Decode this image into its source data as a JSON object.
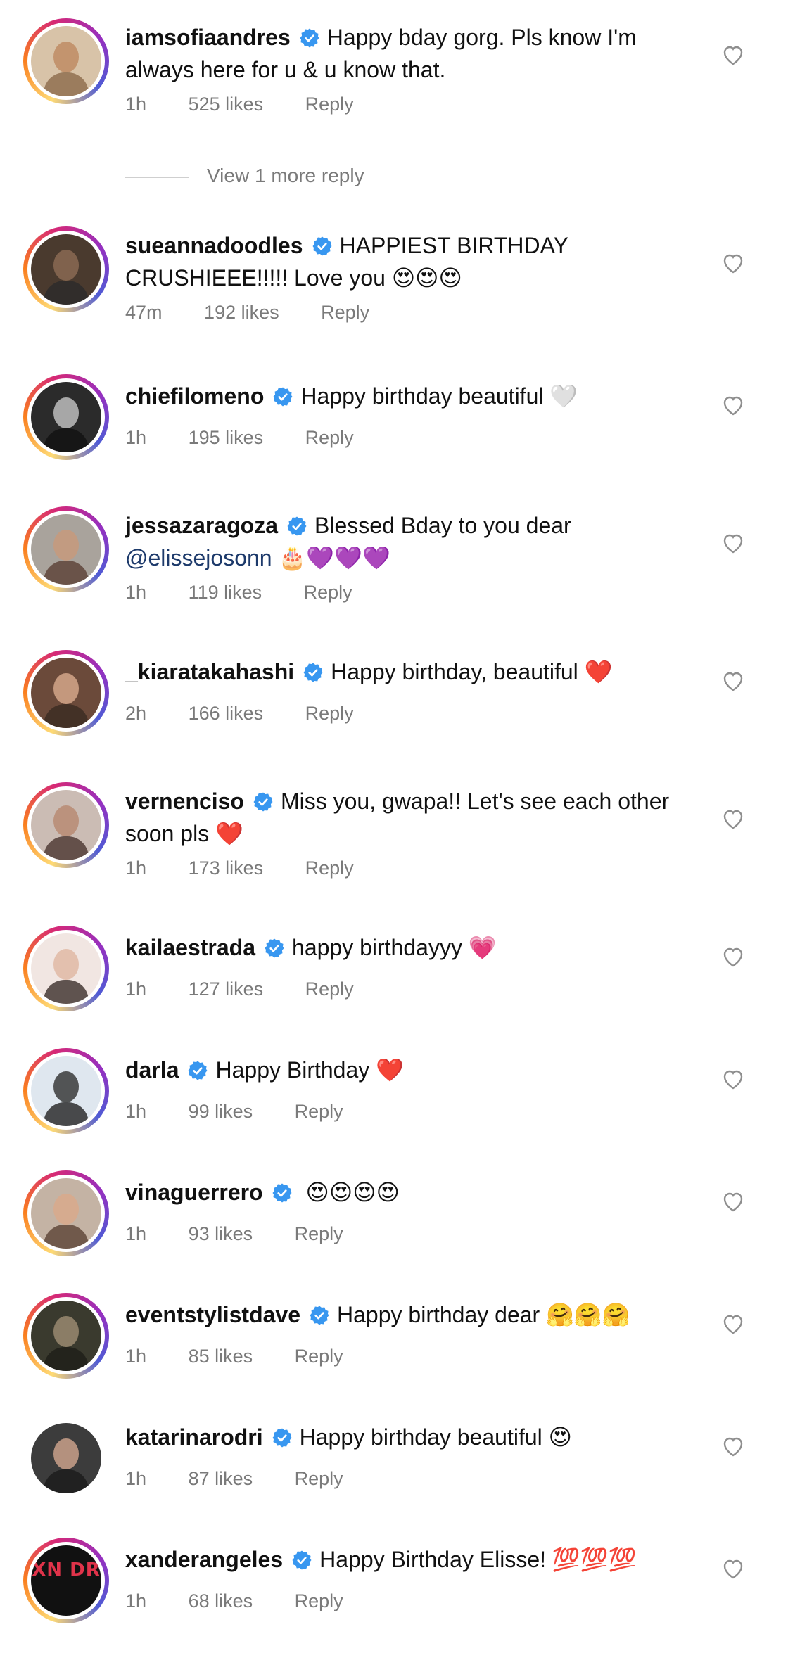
{
  "view_more": {
    "label": "View 1 more reply",
    "after_index": 0
  },
  "comments": [
    {
      "username": "iamsofiaandres",
      "text": "Happy bday gorg. Pls know I'm always here for u & u know that.",
      "mention": "",
      "emoji": "",
      "time": "1h",
      "likes": "525 likes",
      "reply": "Reply",
      "avatar": {
        "ring": true,
        "bg": "#d8c3a8",
        "face": "#c08c64",
        "torso": "#8c6a4a",
        "text": ""
      }
    },
    {
      "username": "sueannadoodles",
      "text": "HAPPIEST BIRTHDAY CRUSHIEEE!!!!! Love you",
      "mention": "",
      "emoji": "😍😍😍",
      "time": "47m",
      "likes": "192 likes",
      "reply": "Reply",
      "avatar": {
        "ring": true,
        "bg": "#4a3a2e",
        "face": "#8a6a52",
        "torso": "#2a2a2a",
        "text": ""
      }
    },
    {
      "username": "chiefilomeno",
      "text": "Happy birthday beautiful",
      "mention": "",
      "emoji": "🤍",
      "time": "1h",
      "likes": "195 likes",
      "reply": "Reply",
      "avatar": {
        "ring": true,
        "bg": "#2b2b2b",
        "face": "#bdbdbd",
        "torso": "#111111",
        "text": ""
      }
    },
    {
      "username": "jessazaragoza",
      "text": "Blessed Bday to you dear",
      "mention": "@elissejosonn",
      "emoji": "🎂💜💜💜",
      "time": "1h",
      "likes": "119 likes",
      "reply": "Reply",
      "avatar": {
        "ring": true,
        "bg": "#a9a39c",
        "face": "#c79a7c",
        "torso": "#5a3e34",
        "text": ""
      }
    },
    {
      "username": "_kiaratakahashi",
      "text": "Happy birthday, beautiful",
      "mention": "",
      "emoji": "❤️",
      "time": "2h",
      "likes": "166 likes",
      "reply": "Reply",
      "avatar": {
        "ring": true,
        "bg": "#6b4a3a",
        "face": "#d4a68a",
        "torso": "#3a2a22",
        "text": ""
      }
    },
    {
      "username": "vernenciso",
      "text": "Miss you, gwapa!! Let's see each other soon pls",
      "mention": "",
      "emoji": "❤️",
      "time": "1h",
      "likes": "173 likes",
      "reply": "Reply",
      "avatar": {
        "ring": true,
        "bg": "#cbbcb4",
        "face": "#b98b73",
        "torso": "#4a3530",
        "text": ""
      }
    },
    {
      "username": "kailaestrada",
      "text": "happy birthdayyy",
      "mention": "",
      "emoji": "💗",
      "time": "1h",
      "likes": "127 likes",
      "reply": "Reply",
      "avatar": {
        "ring": true,
        "bg": "#f1e6e2",
        "face": "#e0b8a4",
        "torso": "#3b2e2a",
        "text": ""
      }
    },
    {
      "username": "darla",
      "text": "Happy Birthday",
      "mention": "",
      "emoji": "❤️",
      "time": "1h",
      "likes": "99 likes",
      "reply": "Reply",
      "avatar": {
        "ring": true,
        "bg": "#dfe7ef",
        "face": "#3a3a3a",
        "torso": "#222222",
        "text": ""
      }
    },
    {
      "username": "vinaguerrero",
      "text": "",
      "mention": "",
      "emoji": "😍😍😍😍",
      "time": "1h",
      "likes": "93 likes",
      "reply": "Reply",
      "avatar": {
        "ring": true,
        "bg": "#c4b3a4",
        "face": "#d9a98c",
        "torso": "#5b4234",
        "text": ""
      }
    },
    {
      "username": "eventstylistdave",
      "text": "Happy birthday dear",
      "mention": "",
      "emoji": "🤗🤗🤗",
      "time": "1h",
      "likes": "85 likes",
      "reply": "Reply",
      "avatar": {
        "ring": true,
        "bg": "#3a3a2e",
        "face": "#9a8a70",
        "torso": "#1e1e18",
        "text": ""
      }
    },
    {
      "username": "katarinarodri",
      "text": "Happy birthday beautiful",
      "mention": "",
      "emoji": "😍",
      "time": "1h",
      "likes": "87 likes",
      "reply": "Reply",
      "avatar": {
        "ring": false,
        "bg": "#3c3c3c",
        "face": "#c9a08a",
        "torso": "#1a1a1a",
        "text": ""
      }
    },
    {
      "username": "xanderangeles",
      "text": "Happy Birthday Elisse!",
      "mention": "",
      "emoji": "💯💯💯",
      "time": "1h",
      "likes": "68 likes",
      "reply": "Reply",
      "avatar": {
        "ring": true,
        "bg": "#111111",
        "face": "",
        "torso": "",
        "text": "XN DR"
      }
    }
  ],
  "colors": {
    "verified_blue": "#3897f0",
    "meta_gray": "#7a7a7a",
    "mention_blue": "#1d3a6b"
  },
  "icons": {
    "verified": "verified-badge-icon",
    "like": "heart-outline-icon"
  }
}
